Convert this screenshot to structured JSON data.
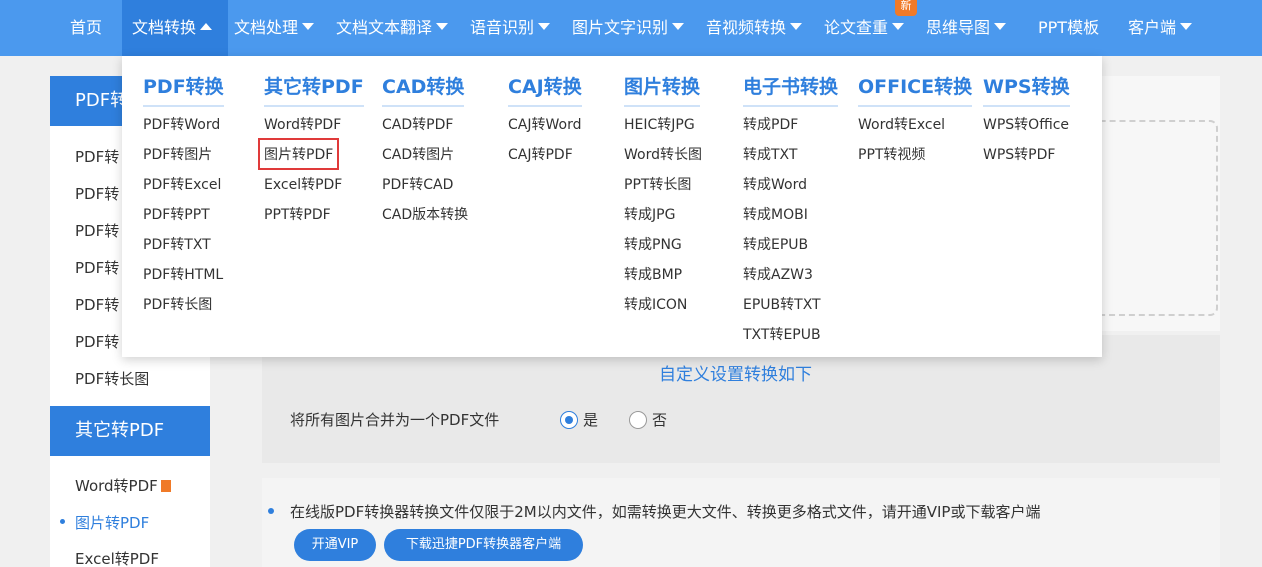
{
  "nav": {
    "items": [
      {
        "label": "首页",
        "caret": false
      },
      {
        "label": "文档转换",
        "caret": true,
        "active": true
      },
      {
        "label": "文档处理",
        "caret": true
      },
      {
        "label": "文档文本翻译",
        "caret": true
      },
      {
        "label": "语音识别",
        "caret": true
      },
      {
        "label": "图片文字识别",
        "caret": true
      },
      {
        "label": "音视频转换",
        "caret": true
      },
      {
        "label": "论文查重",
        "caret": true
      },
      {
        "label": "思维导图",
        "caret": true
      },
      {
        "label": "PPT模板",
        "caret": false
      },
      {
        "label": "客户端",
        "caret": true
      }
    ],
    "new_badge": "新"
  },
  "dropdown": {
    "columns": [
      {
        "title": "PDF转换",
        "links": [
          "PDF转Word",
          "PDF转图片",
          "PDF转Excel",
          "PDF转PPT",
          "PDF转TXT",
          "PDF转HTML",
          "PDF转长图"
        ]
      },
      {
        "title": "其它转PDF",
        "links": [
          "Word转PDF",
          "图片转PDF",
          "Excel转PDF",
          "PPT转PDF"
        ]
      },
      {
        "title": "CAD转换",
        "links": [
          "CAD转PDF",
          "CAD转图片",
          "PDF转CAD",
          "CAD版本转换"
        ]
      },
      {
        "title": "CAJ转换",
        "links": [
          "CAJ转Word",
          "CAJ转PDF"
        ]
      },
      {
        "title": "图片转换",
        "links": [
          "HEIC转JPG",
          "Word转长图",
          "PPT转长图",
          "转成JPG",
          "转成PNG",
          "转成BMP",
          "转成ICON"
        ]
      },
      {
        "title": "电子书转换",
        "links": [
          "转成PDF",
          "转成TXT",
          "转成Word",
          "转成MOBI",
          "转成EPUB",
          "转成AZW3",
          "EPUB转TXT",
          "TXT转EPUB"
        ]
      },
      {
        "title": "OFFICE转换",
        "links": [
          "Word转Excel",
          "PPT转视频"
        ]
      },
      {
        "title": "WPS转换",
        "links": [
          "WPS转Office",
          "WPS转PDF"
        ]
      }
    ]
  },
  "sidebar": {
    "group1_title": "PDF转",
    "group1_items": [
      "PDF转",
      "PDF转",
      "PDF转",
      "PDF转",
      "PDF转",
      "PDF转",
      "PDF转长图"
    ],
    "group2_title": "其它转PDF",
    "group2_items": [
      "Word转PDF",
      "图片转PDF",
      "Excel转PDF"
    ]
  },
  "main": {
    "custom_settings_link": "自定义设置转换如下",
    "merge_label": "将所有图片合并为一个PDF文件",
    "option_yes": "是",
    "option_no": "否",
    "notice": "在线版PDF转换器转换文件仅限于2M以内文件，如需转换更大文件、转换更多格式文件，请开通VIP或下载客户端",
    "vip_button": "开通VIP",
    "download_button": "下载迅捷PDF转换器客户端"
  }
}
